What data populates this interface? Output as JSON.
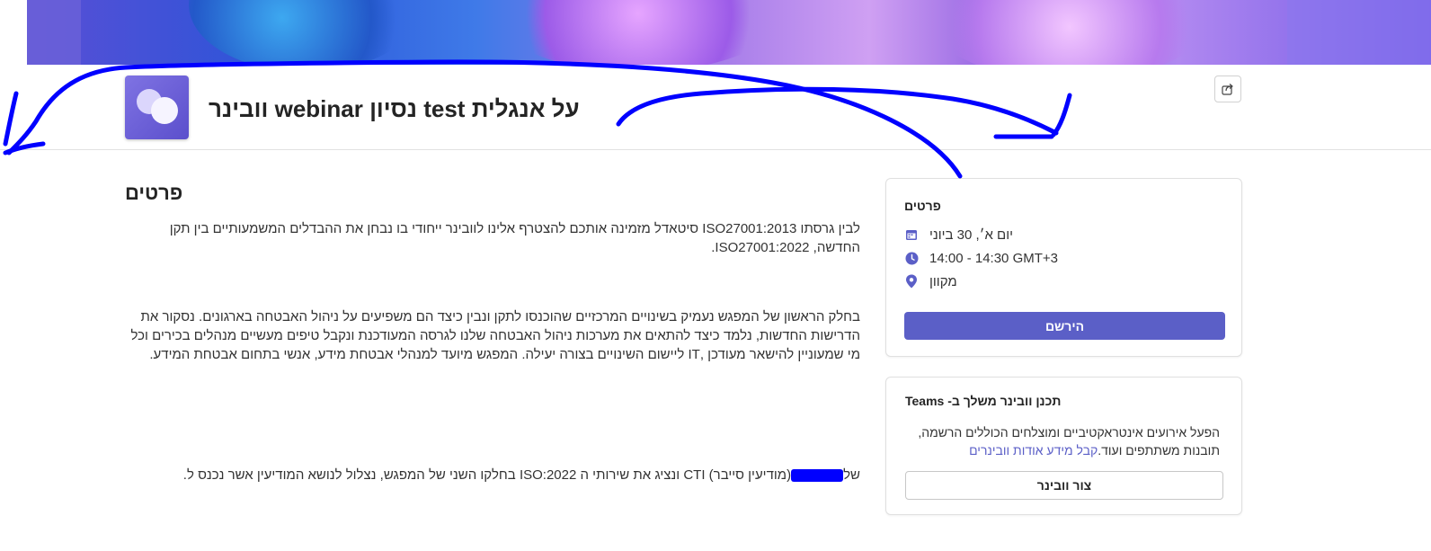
{
  "event": {
    "title": "על אנגלית test נסיון webinar וובינר",
    "details_heading": "פרטים",
    "paragraphs": [
      "לבין גרסתו ISO27001:2013 סיטאדל מזמינה אותכם להצטרף אלינו לוובינר ייחודי בו נבחן את ההבדלים המשמעותיים בין תקן החדשה, ISO27001:2022.",
      "בחלק הראשון של המפגש נעמיק בשינויים המרכזיים שהוכנסו לתקן ונבין כיצד הם משפיעים על ניהול האבטחה בארגונים. נסקור את הדרישות החדשות, נלמד כיצד להתאים את מערכות ניהול האבטחה שלנו לגרסה המעודכנת ונקבל טיפים מעשיים מנהלים בכירים וכל מי שמעוניין להישאר מעודכן ,IT ליישום השינויים בצורה יעילה. המפגש מיועד למנהלי אבטחת מידע, אנשי בתחום אבטחת המידע.",
      "של"
    ],
    "paragraph3_rest": "(מודיעין סייבר) CTI ונציג את שירותי ה ISO:2022 בחלקו השני של המפגש, נצלול לנושא המודיעין אשר נכנס ל."
  },
  "details_card": {
    "title": "פרטים",
    "date": "יום א׳, 30 ביוני",
    "time": "14:00 - 14:30 GMT+3",
    "location": "מקוון",
    "register_label": "הירשם"
  },
  "teams_card": {
    "title": "Teams -תכנן וובינר משלך ב",
    "text": "הפעל אירועים אינטראקטיביים ומוצלחים הכוללים הרשמה, תובנות משתתפים ועוד.",
    "link_text": "קבל מידע אודות וובינרים",
    "create_label": "צור וובינר"
  },
  "colors": {
    "accent": "#5b5fc7",
    "annotation": "#0000ff"
  },
  "icons": {
    "share": "share-icon",
    "calendar": "calendar-icon",
    "clock": "clock-icon",
    "location": "location-pin-icon"
  }
}
